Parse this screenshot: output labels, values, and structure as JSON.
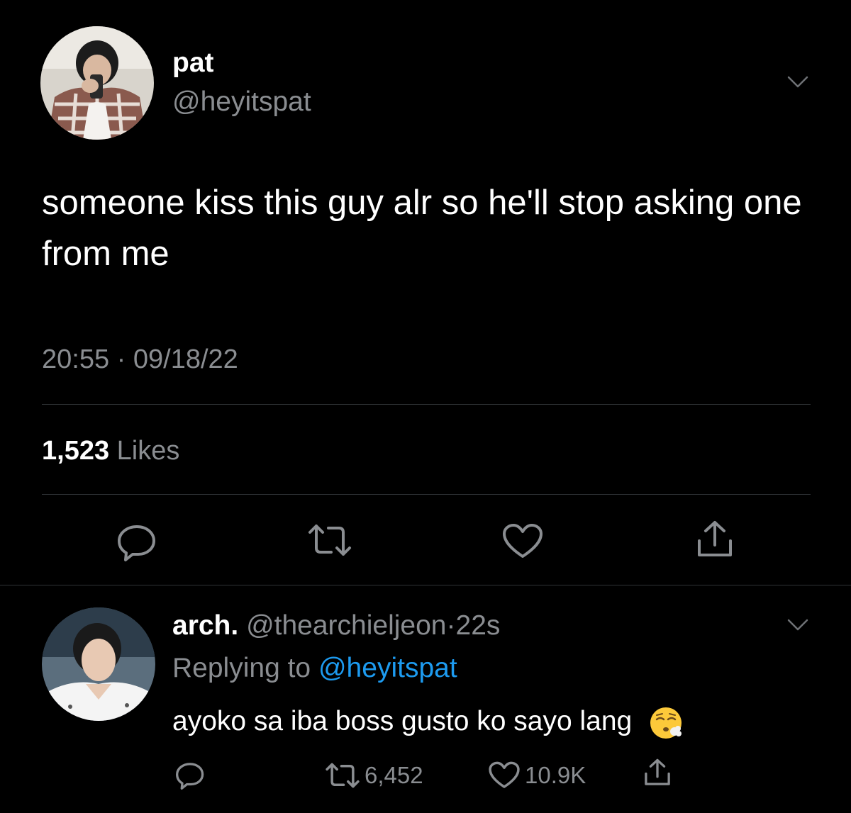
{
  "tweet": {
    "author_name": "pat",
    "author_handle": "@heyitspat",
    "text": "someone kiss this guy alr so he'll stop asking one from me",
    "meta": "20:55 · 09/18/22",
    "likes_count": "1,523",
    "likes_label": "Likes",
    "actions": [
      "reply-icon",
      "retweet-icon",
      "heart-icon",
      "share-icon"
    ]
  },
  "reply": {
    "author_name": "arch.",
    "author_handle": "@thearchieljeon",
    "separator": "·",
    "time": "22s",
    "replying_prefix": "Replying to",
    "replying_to": "@heyitspat",
    "text": "ayoko sa iba boss gusto ko sayo lang",
    "emoji": "face-exhaling-emoji",
    "retweets": "6,452",
    "likes": "10.9K"
  },
  "colors": {
    "background": "#000000",
    "text": "#ffffff",
    "secondary": "#8a8d91",
    "link": "#1d9bf0",
    "divider": "#2f3336"
  }
}
